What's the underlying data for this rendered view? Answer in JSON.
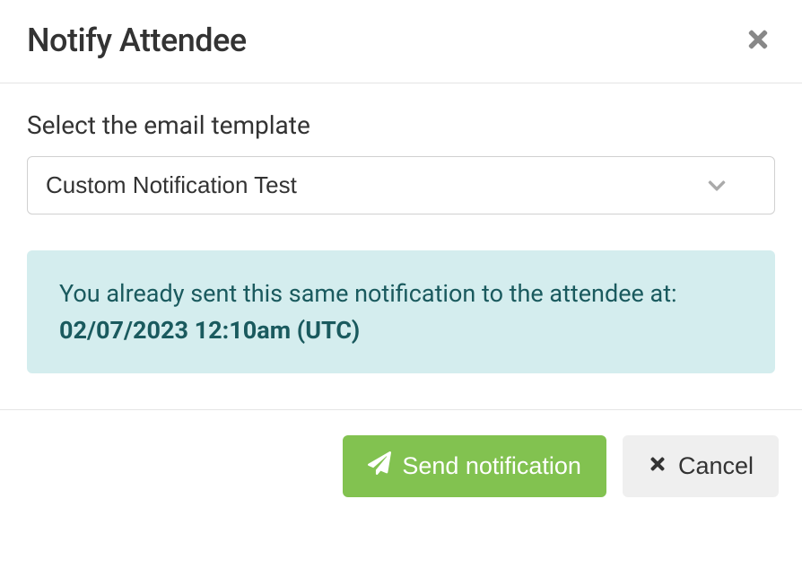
{
  "modal": {
    "title": "Notify Attendee",
    "template_label": "Select the email template",
    "template_selected": "Custom Notification Test",
    "alert_prefix": "You already sent this same notification to the attendee at: ",
    "alert_timestamp": "02/07/2023 12:10am (UTC)",
    "send_label": "Send notification",
    "cancel_label": "Cancel"
  }
}
